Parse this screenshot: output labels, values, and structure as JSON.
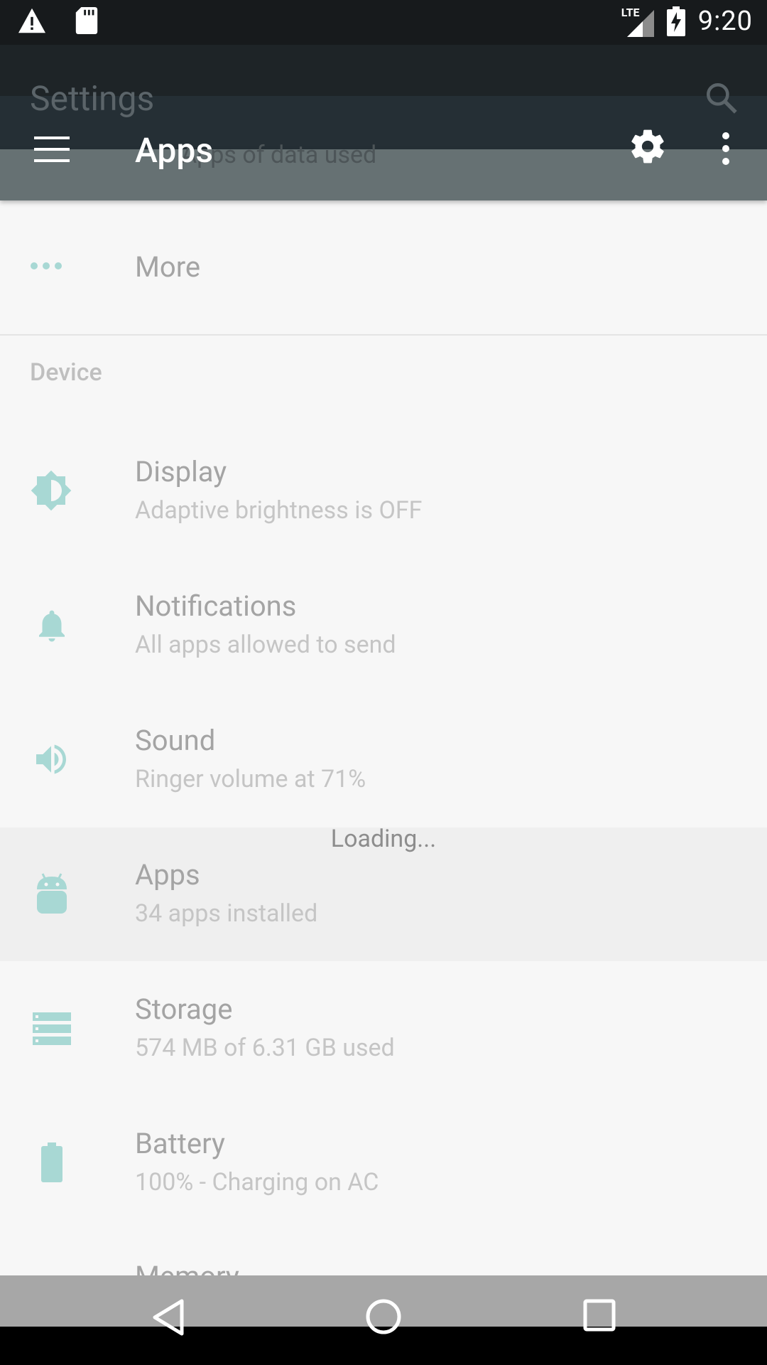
{
  "status_bar": {
    "time": "9:20",
    "network": "LTE"
  },
  "background": {
    "settings_title": "Settings",
    "data_used_text": "Apps of data used"
  },
  "app_bar": {
    "title": "Apps"
  },
  "list": {
    "more_label": "More",
    "section_device": "Device",
    "items": [
      {
        "title": "Display",
        "subtitle": "Adaptive brightness is OFF",
        "icon": "brightness-icon"
      },
      {
        "title": "Notifications",
        "subtitle": "All apps allowed to send",
        "icon": "bell-icon"
      },
      {
        "title": "Sound",
        "subtitle": "Ringer volume at 71%",
        "icon": "volume-icon"
      },
      {
        "title": "Apps",
        "subtitle": "34 apps installed",
        "icon": "android-icon"
      },
      {
        "title": "Storage",
        "subtitle": "574 MB of 6.31 GB used",
        "icon": "storage-icon"
      },
      {
        "title": "Battery",
        "subtitle": "100% - Charging on AC",
        "icon": "battery-icon"
      }
    ],
    "partial_item": "Memory"
  },
  "loading_text": "Loading...",
  "colors": {
    "accent": "#80cbc4",
    "appbar": "#252f35",
    "status_bar": "#171a1c"
  }
}
